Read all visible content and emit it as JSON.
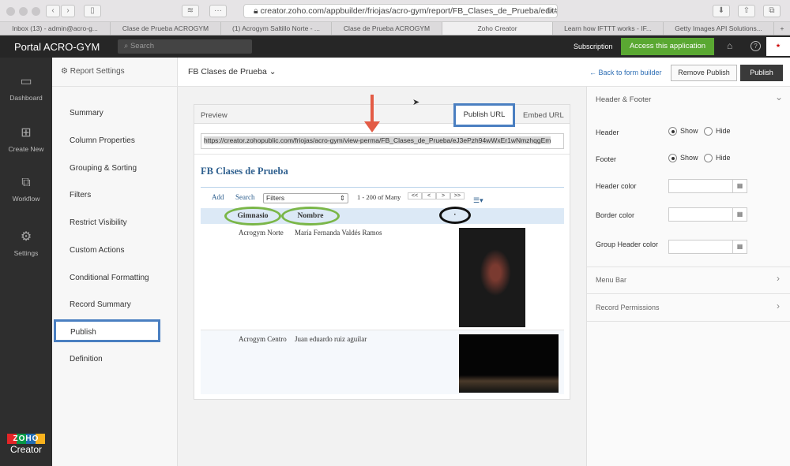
{
  "browser": {
    "url": "creator.zoho.com/appbuilder/friojas/acro-gym/report/FB_Clases_de_Prueba/edit#pu",
    "tabs": [
      "Inbox (13) - admin@acro-g...",
      "Clase de Prueba ACROGYM",
      "(1) Acrogym Saltillo Norte - ...",
      "Clase de Prueba ACROGYM",
      "Zoho Creator",
      "Learn how IFTTT works - IF...",
      "Getty Images API Solutions..."
    ],
    "active_tab": 4
  },
  "header": {
    "title": "Portal ACRO-GYM",
    "search_placeholder": "Search",
    "subscription": "Subscription",
    "access_button": "Access this application",
    "accent": "#5aa832"
  },
  "sidebar": {
    "items": [
      {
        "label": "Dashboard",
        "icon": "monitor-icon"
      },
      {
        "label": "Create New",
        "icon": "plus-square-icon"
      },
      {
        "label": "Workflow",
        "icon": "workflow-icon"
      },
      {
        "label": "Settings",
        "icon": "gear-icon"
      }
    ],
    "logo_top": "ZOHO",
    "logo_bottom": "Creator"
  },
  "report_settings": {
    "title": "Report Settings",
    "items": [
      "Summary",
      "Column Properties",
      "Grouping & Sorting",
      "Filters",
      "Restrict Visibility",
      "Custom Actions",
      "Conditional Formatting",
      "Record Summary",
      "Publish",
      "Definition"
    ],
    "active": "Publish"
  },
  "topbar": {
    "report_name": "FB Clases de Prueba",
    "back_link": "← Back to form builder",
    "remove_publish": "Remove Publish",
    "publish": "Publish"
  },
  "preview": {
    "label": "Preview",
    "tab_publish_url": "Publish URL",
    "tab_embed_url": "Embed URL",
    "url": "https://creator.zohopublic.com/friojas/acro-gym/view-perma/FB_Clases_de_Prueba/eJ3ePzh94wWxEr1wNmzhqgEm",
    "report_title": "FB Clases de Prueba",
    "add": "Add",
    "search": "Search",
    "filters": "Filters",
    "pagination": "1 - 200 of Many",
    "pager": [
      "<<",
      "<",
      ">",
      ">>"
    ],
    "columns": [
      "Gimnasio",
      "Nombre",
      "·"
    ],
    "rows": [
      {
        "gimnasio": "Acrogym Norte",
        "nombre": "María Fernanda Valdés Ramos"
      },
      {
        "gimnasio": "Acrogym Centro",
        "nombre": "Juan eduardo ruiz aguilar"
      }
    ]
  },
  "right_panel": {
    "section": "Header & Footer",
    "header_label": "Header",
    "footer_label": "Footer",
    "show": "Show",
    "hide": "Hide",
    "header_color": "Header color",
    "border_color": "Border color",
    "group_header_color": "Group Header color",
    "menu_bar": "Menu Bar",
    "record_permissions": "Record Permissions"
  }
}
